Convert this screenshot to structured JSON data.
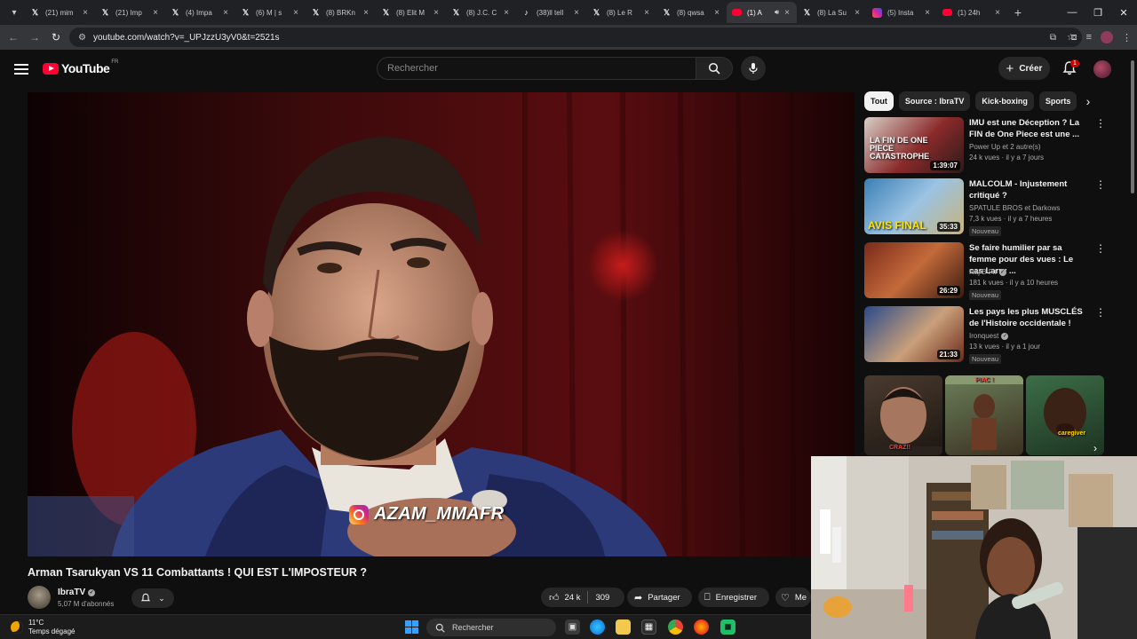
{
  "browser": {
    "tabs": [
      {
        "label": "(21) mim",
        "icon": "x-logo-icon",
        "active": false
      },
      {
        "label": "(21) Imp",
        "icon": "x-logo-icon",
        "active": false
      },
      {
        "label": "(4) Impa",
        "icon": "x-logo-icon",
        "active": false
      },
      {
        "label": "(6) M | s",
        "icon": "x-logo-icon",
        "active": false
      },
      {
        "label": "(8) BRKn",
        "icon": "x-logo-icon",
        "active": false
      },
      {
        "label": "(8) Elit M",
        "icon": "x-logo-icon",
        "active": false
      },
      {
        "label": "(8) J.C. C",
        "icon": "x-logo-icon",
        "active": false
      },
      {
        "label": "(38)ll tell",
        "icon": "tiktok-icon",
        "active": false
      },
      {
        "label": "(8) Le R",
        "icon": "x-logo-icon",
        "active": false
      },
      {
        "label": "(8) qwsa",
        "icon": "x-logo-icon",
        "active": false
      },
      {
        "label": "(1) A",
        "icon": "youtube-icon",
        "active": true
      },
      {
        "label": "(8) La Su",
        "icon": "x-logo-icon",
        "active": false
      },
      {
        "label": "(5) Insta",
        "icon": "instagram-icon",
        "active": false
      },
      {
        "label": "(1) 24h",
        "icon": "youtube-icon",
        "active": false
      }
    ],
    "url": "youtube.com/watch?v=_UPJzzU3yV0&t=2521s"
  },
  "masthead": {
    "logo_text": "YouTube",
    "country": "FR",
    "search_placeholder": "Rechercher",
    "create_label": "Créer",
    "notification_count": "1"
  },
  "video": {
    "caption_overlay": "AZAM_MMAFR",
    "title": "Arman Tsarukyan VS 11 Combattants ! QUI EST L'IMPOSTEUR ?",
    "channel": "IbraTV",
    "subscribers": "5,07 M d'abonnés",
    "likes": "24 k",
    "comments": "309",
    "share_label": "Partager",
    "save_label": "Enregistrer",
    "more_label": "Me"
  },
  "chips": [
    "Tout",
    "Source : IbraTV",
    "Kick-boxing",
    "Sports"
  ],
  "recommendations": [
    {
      "title": "IMU est une Déception ? La FIN de One Piece est une ...",
      "channel": "Power Up et 2 autre(s)",
      "verified": false,
      "meta": "24 k vues · il y a 7 jours",
      "duration": "1:39:07",
      "badge": "",
      "thumb_text": "LA FIN DE ONE PIECE CATASTROPHE"
    },
    {
      "title": "MALCOLM - Injustement critiqué ?",
      "channel": "SPATULE BROS et Darkows",
      "verified": false,
      "meta": "7,3 k vues · il y a 7 heures",
      "duration": "35:33",
      "badge": "Nouveau",
      "thumb_text": "AVIS FINAL"
    },
    {
      "title": "Se faire humilier par sa femme pour des vues : Le cas Larry ...",
      "channel": "Naj B Fit",
      "verified": true,
      "meta": "181 k vues · il y a 10 heures",
      "duration": "26:29",
      "badge": "Nouveau",
      "thumb_text": ""
    },
    {
      "title": "Les pays les plus MUSCLÉS de l'Histoire occidentale !",
      "channel": "Ironquest",
      "verified": true,
      "meta": "13 k vues · il y a 1 jour",
      "duration": "21:33",
      "badge": "Nouveau",
      "thumb_text": ""
    }
  ],
  "shorts": [
    {
      "tag": "CRAZ!!"
    },
    {
      "tag": "PIAC !"
    },
    {
      "tag": "caregiver"
    }
  ],
  "taskbar": {
    "temperature": "11°C",
    "weather": "Temps dégagé",
    "search_label": "Rechercher"
  },
  "colors": {
    "yt_red": "#ff0033",
    "background": "#0f0f0f",
    "chip_bg": "#272727"
  }
}
